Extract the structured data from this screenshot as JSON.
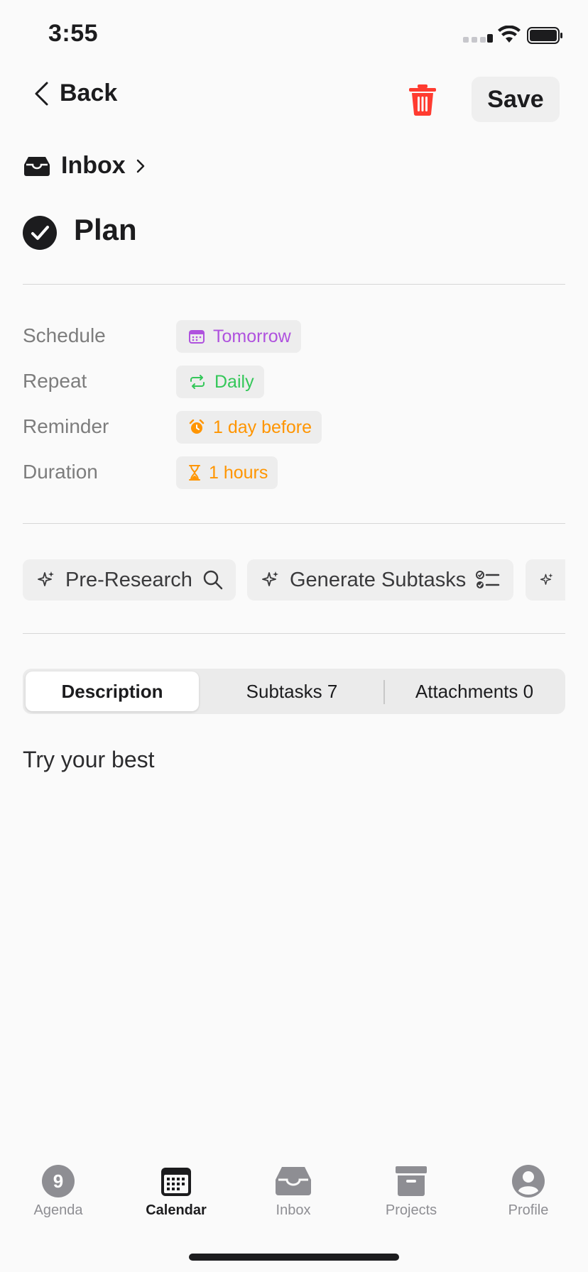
{
  "status_bar": {
    "time": "3:55"
  },
  "nav": {
    "back_label": "Back",
    "save_label": "Save"
  },
  "breadcrumb": {
    "label": "Inbox"
  },
  "task": {
    "title": "Plan"
  },
  "properties": {
    "schedule": {
      "label": "Schedule",
      "value": "Tomorrow",
      "color": "#af52de"
    },
    "repeat": {
      "label": "Repeat",
      "value": "Daily",
      "color": "#34c759"
    },
    "reminder": {
      "label": "Reminder",
      "value": "1 day before",
      "color": "#ff9500"
    },
    "duration": {
      "label": "Duration",
      "value": "1 hours",
      "color": "#ff9500"
    }
  },
  "ai_actions": [
    {
      "label": "Pre-Research"
    },
    {
      "label": "Generate Subtasks"
    }
  ],
  "tabs": {
    "description": "Description",
    "subtasks": "Subtasks 7",
    "attachments": "Attachments 0"
  },
  "description": {
    "text": "Try your best"
  },
  "tab_bar": {
    "agenda": {
      "label": "Agenda",
      "badge": "9"
    },
    "calendar": {
      "label": "Calendar"
    },
    "inbox": {
      "label": "Inbox"
    },
    "projects": {
      "label": "Projects"
    },
    "profile": {
      "label": "Profile"
    }
  },
  "colors": {
    "delete": "#ff3b30",
    "text": "#1c1c1e",
    "muted": "#8e8e93"
  }
}
